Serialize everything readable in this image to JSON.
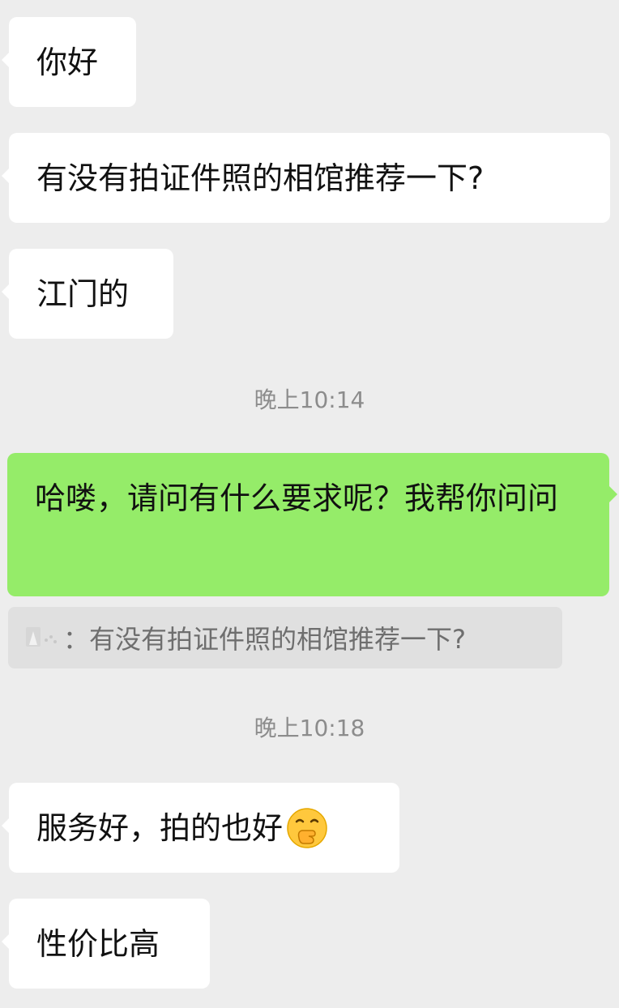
{
  "messages": [
    {
      "text": "你好"
    },
    {
      "text": "有没有拍证件照的相馆推荐一下?"
    },
    {
      "text": "江门的"
    },
    {
      "timestamp": "晚上10:14"
    },
    {
      "text": "哈喽，请问有什么要求呢？我帮你问问"
    },
    {
      "quote": "：有没有拍证件照的相馆推荐一下?"
    },
    {
      "timestamp": "晚上10:18"
    },
    {
      "text": "服务好，拍的也好",
      "emoji": "hand-over-mouth-emoji"
    },
    {
      "text": "性价比高"
    }
  ],
  "colors": {
    "background": "#ededed",
    "incoming_bubble": "#ffffff",
    "outgoing_bubble": "#95ec69",
    "timestamp_text": "#8c8c8c",
    "quote_background": "#e0e0e0"
  }
}
